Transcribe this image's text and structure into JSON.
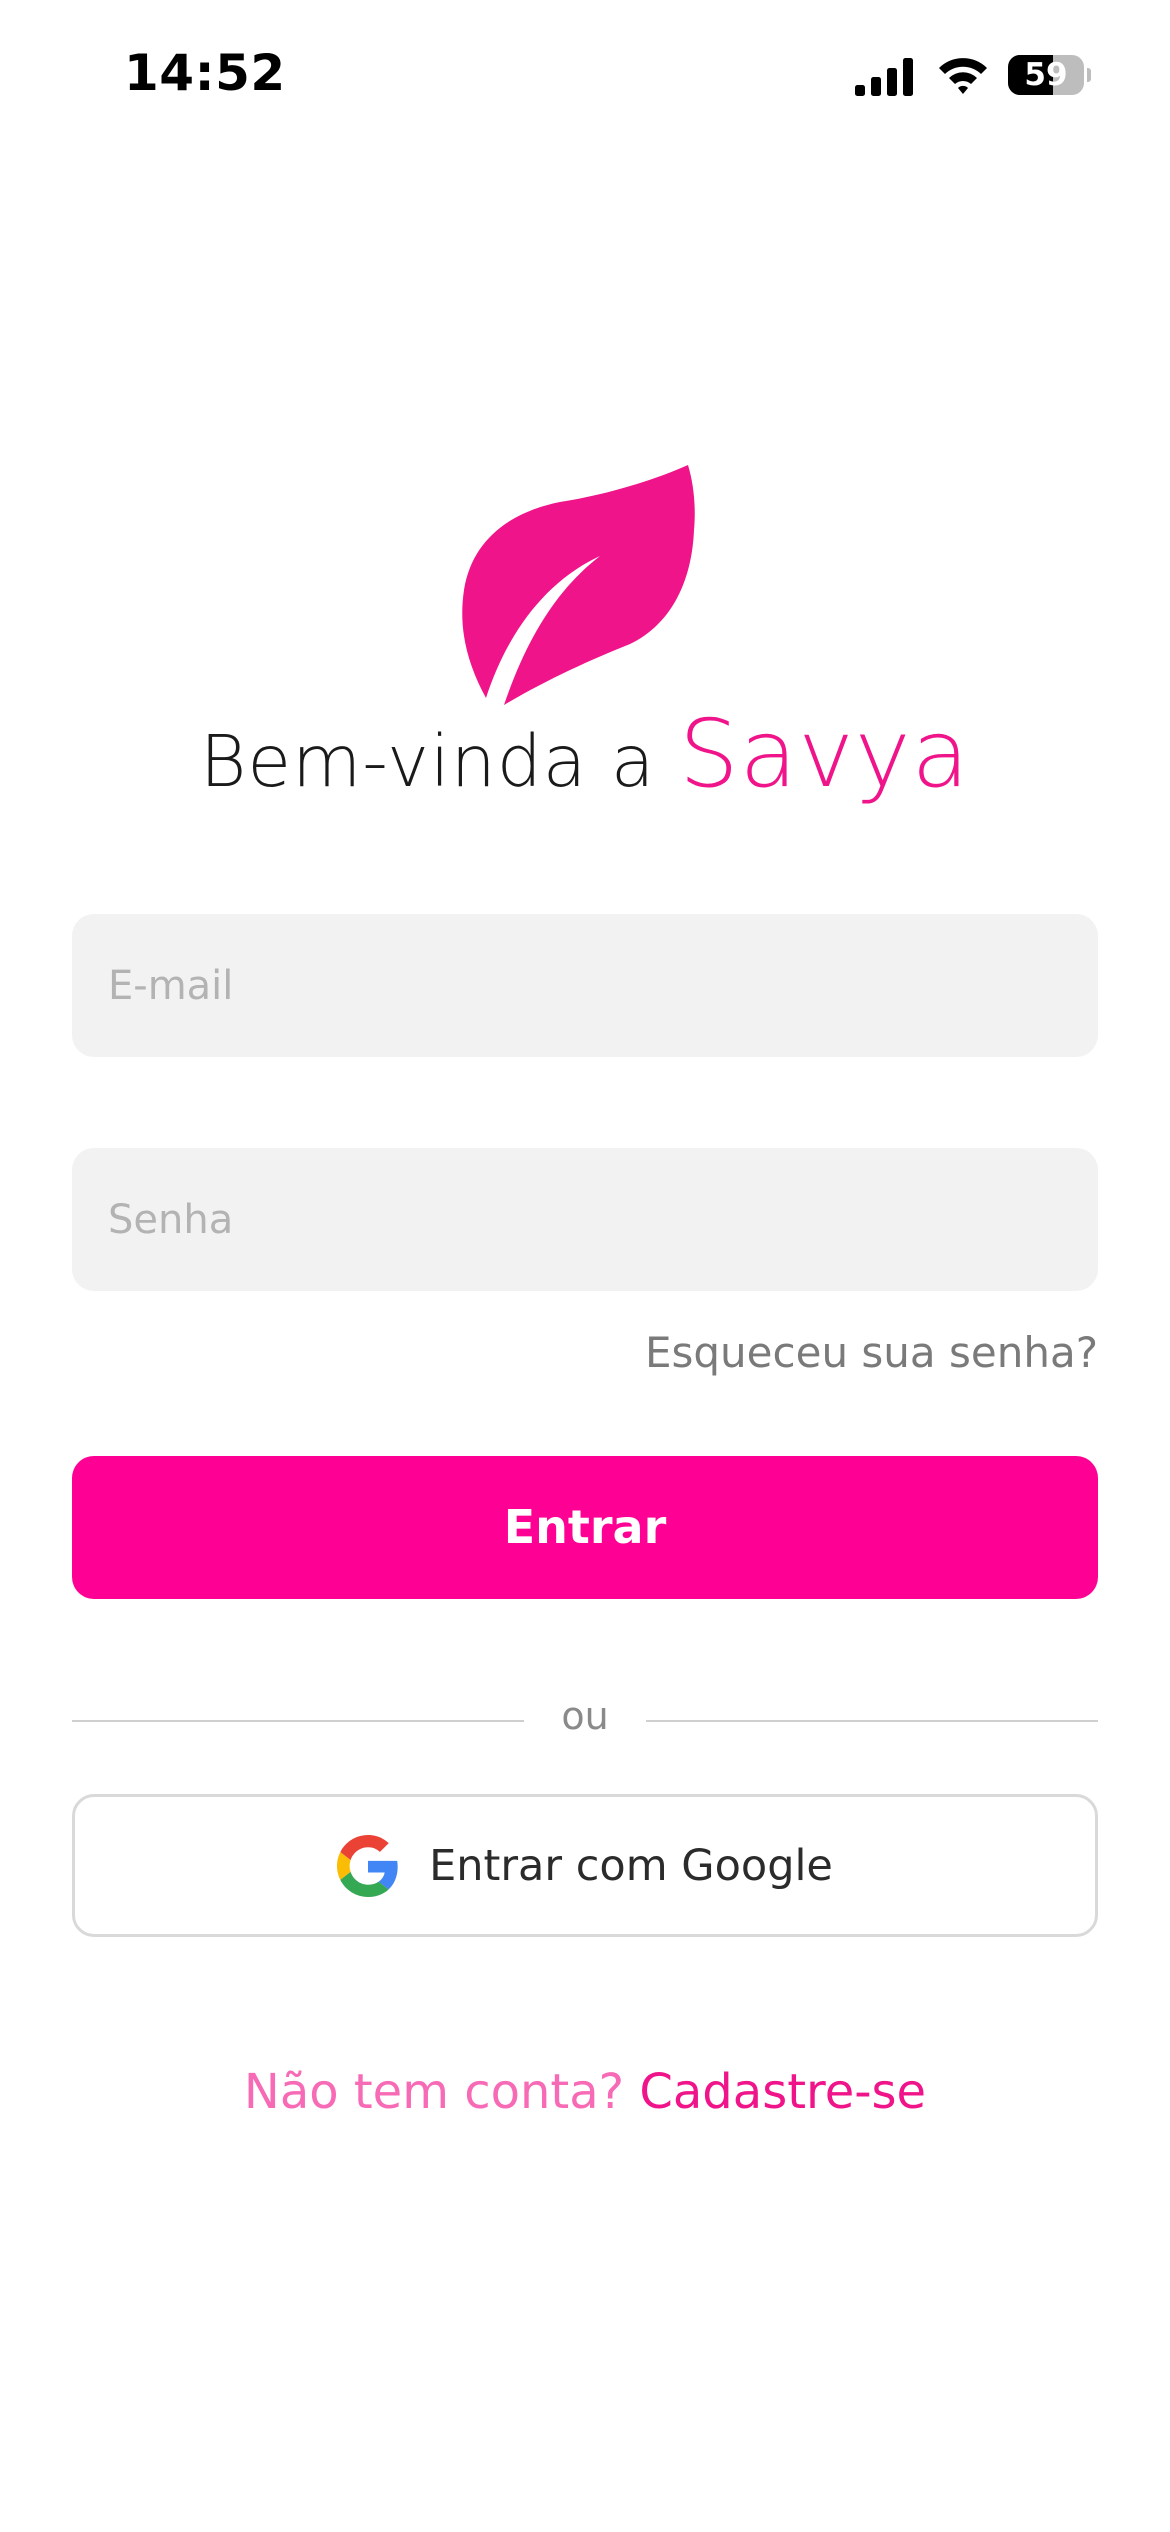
{
  "status_bar": {
    "time": "14:52",
    "battery_level": "59",
    "battery_fraction": 0.59
  },
  "welcome": {
    "prefix": "Bem-vinda a ",
    "brand": "Savya"
  },
  "form": {
    "email_placeholder": "E-mail",
    "password_placeholder": "Senha",
    "forgot_password": "Esqueceu sua senha?",
    "login_label": "Entrar"
  },
  "divider": {
    "text": "ou"
  },
  "google": {
    "label": "Entrar com Google"
  },
  "signup": {
    "prompt": "Não tem conta? ",
    "link": "Cadastre-se"
  },
  "colors": {
    "brand_pink": "#f0148a",
    "button_pink": "#ff0095",
    "signup_prompt_pink": "#f76ab5",
    "field_background": "#f2f2f2"
  },
  "icons": {
    "logo": "leaf-logo-icon",
    "signal": "cellular-signal-icon",
    "wifi": "wifi-icon",
    "battery": "battery-icon",
    "google": "google-g-icon"
  }
}
